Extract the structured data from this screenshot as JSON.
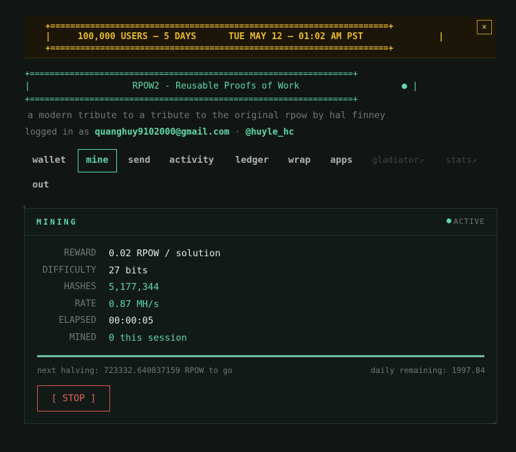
{
  "banner": {
    "users_text": "100,000 USERS — 5 DAYS",
    "date_text": "TUE MAY 12 — 01:02 AM PST",
    "close_label": "×"
  },
  "title_box": {
    "title": "RPOW2 - Reusable Proofs of Work",
    "dot": "●"
  },
  "tagline": "a modern tribute to a tribute to the original rpow by hal finney",
  "login": {
    "prefix": "logged in as",
    "email": "quanghuy9102000@gmail.com",
    "separator": "·",
    "handle": "@huyle_hc"
  },
  "nav": {
    "items": [
      {
        "label": "wallet"
      },
      {
        "label": "mine"
      },
      {
        "label": "send"
      },
      {
        "label": "activity"
      },
      {
        "label": "ledger"
      },
      {
        "label": "wrap"
      },
      {
        "label": "apps"
      },
      {
        "label": "gladiator↗"
      },
      {
        "label": "stats↗"
      },
      {
        "label": "out"
      }
    ],
    "active": "mine"
  },
  "panel": {
    "title": "MINING",
    "status": "ACTIVE",
    "stats": [
      {
        "key": "REWARD",
        "value": "0.02 RPOW / solution"
      },
      {
        "key": "DIFFICULTY",
        "value": "27 bits"
      },
      {
        "key": "HASHES",
        "value": "5,177,344"
      },
      {
        "key": "RATE",
        "value": "0.87 MH/s"
      },
      {
        "key": "ELAPSED",
        "value": "00:00:05"
      },
      {
        "key": "MINED",
        "value": "0 this session"
      }
    ],
    "progress": 1.0,
    "next_halving": "next halving: 723332.640837159 RPOW to go",
    "daily_remaining": "daily remaining: 1997.84",
    "stop_label": "[ STOP ]"
  },
  "colors": {
    "accent": "#5fd9a6",
    "banner": "#e7b72e",
    "stop": "#e0655a",
    "background": "#111615"
  }
}
